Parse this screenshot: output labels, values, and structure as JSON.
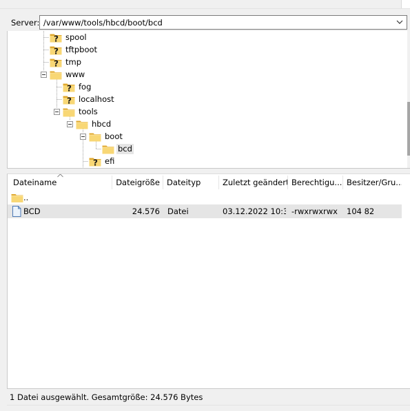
{
  "remote": {
    "server_label": "Server:",
    "path": "/var/www/tools/hbcd/boot/bcd"
  },
  "tree": {
    "nodes": [
      {
        "name": "spool",
        "icon": "unknown-folder-icon"
      },
      {
        "name": "tftpboot",
        "icon": "unknown-folder-icon"
      },
      {
        "name": "tmp",
        "icon": "unknown-folder-icon"
      },
      {
        "name": "www",
        "icon": "folder-icon"
      },
      {
        "name": "fog",
        "icon": "unknown-folder-icon"
      },
      {
        "name": "localhost",
        "icon": "unknown-folder-icon"
      },
      {
        "name": "tools",
        "icon": "folder-icon"
      },
      {
        "name": "hbcd",
        "icon": "folder-icon"
      },
      {
        "name": "boot",
        "icon": "folder-icon"
      },
      {
        "name": "bcd",
        "icon": "folder-icon",
        "selected": true
      },
      {
        "name": "efi",
        "icon": "unknown-folder-icon"
      }
    ]
  },
  "filelist": {
    "columns": [
      "Dateiname",
      "Dateigröße",
      "Dateityp",
      "Zuletzt geändert",
      "Berechtigu...",
      "Besitzer/Gru..."
    ],
    "rows": [
      {
        "name": "..",
        "size": "",
        "type": "",
        "modified": "",
        "perms": "",
        "owner": "",
        "icon": "folder-icon"
      },
      {
        "name": "BCD",
        "size": "24.576",
        "type": "Datei",
        "modified": "03.12.2022 10:3...",
        "perms": "-rwxrwxrwx",
        "owner": "104 82",
        "icon": "file-icon",
        "selected": true
      }
    ]
  },
  "status": {
    "text": "1 Datei ausgewählt. Gesamtgröße: 24.576 Bytes"
  },
  "colors": {
    "folder": "#f8d775",
    "folder_dark": "#e0a82e",
    "question": "#1a1a1a",
    "selection": "#e5e5e5"
  }
}
